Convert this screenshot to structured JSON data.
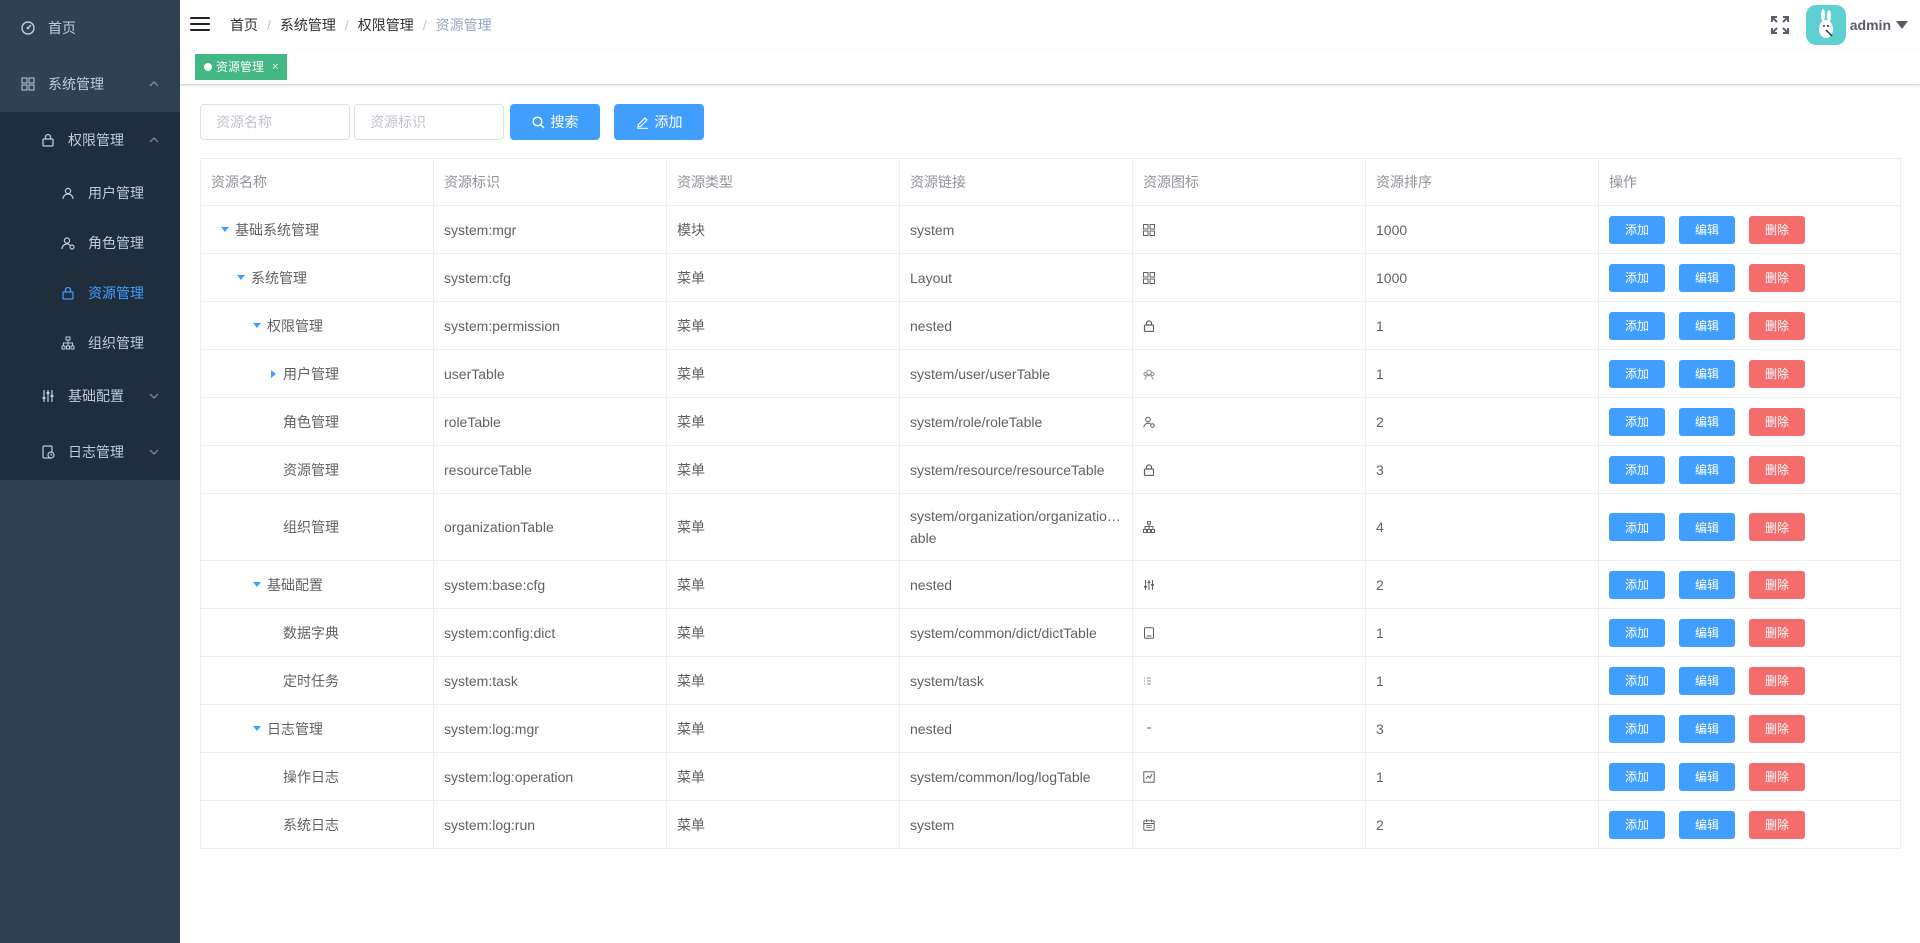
{
  "sidebar": {
    "items": [
      {
        "label": "首页",
        "icon": "dashboard-icon"
      },
      {
        "label": "系统管理",
        "icon": "grid-icon"
      },
      {
        "label": "权限管理",
        "icon": "lock-icon"
      },
      {
        "label": "用户管理",
        "icon": "peoples-icon"
      },
      {
        "label": "角色管理",
        "icon": "user-gear-icon"
      },
      {
        "label": "资源管理",
        "icon": "lock-icon",
        "active": true
      },
      {
        "label": "组织管理",
        "icon": "tree-icon"
      },
      {
        "label": "基础配置",
        "icon": "sliders-icon"
      },
      {
        "label": "日志管理",
        "icon": "log-icon"
      }
    ]
  },
  "header": {
    "breadcrumb": [
      "首页",
      "系统管理",
      "权限管理",
      "资源管理"
    ],
    "username": "admin"
  },
  "tags": {
    "active": "资源管理",
    "close": "×"
  },
  "toolbar": {
    "name_placeholder": "资源名称",
    "key_placeholder": "资源标识",
    "search_label": "搜索",
    "add_label": "添加"
  },
  "table": {
    "columns": [
      "资源名称",
      "资源标识",
      "资源类型",
      "资源链接",
      "资源图标",
      "资源排序",
      "操作"
    ],
    "ops": {
      "add": "添加",
      "edit": "编辑",
      "delete": "删除"
    },
    "rows": [
      {
        "name": "基础系统管理",
        "key": "system:mgr",
        "type": "模块",
        "link": "system",
        "icon": "grid-icon",
        "sort": "1000"
      },
      {
        "name": "系统管理",
        "key": "system:cfg",
        "type": "菜单",
        "link": "Layout",
        "icon": "grid-icon",
        "sort": "1000"
      },
      {
        "name": "权限管理",
        "key": "system:permission",
        "type": "菜单",
        "link": "nested",
        "icon": "lock-icon",
        "sort": "1"
      },
      {
        "name": "用户管理",
        "key": "userTable",
        "type": "菜单",
        "link": "system/user/userTable",
        "icon": "peoples-icon",
        "sort": "1"
      },
      {
        "name": "角色管理",
        "key": "roleTable",
        "type": "菜单",
        "link": "system/role/roleTable",
        "icon": "user-gear-icon",
        "sort": "2"
      },
      {
        "name": "资源管理",
        "key": "resourceTable",
        "type": "菜单",
        "link": "system/resource/resourceTable",
        "icon": "lock-icon",
        "sort": "3"
      },
      {
        "name": "组织管理",
        "key": "organizationTable",
        "type": "菜单",
        "link": "system/organization/organizatio…able",
        "icon": "tree-icon",
        "sort": "4"
      },
      {
        "name": "基础配置",
        "key": "system:base:cfg",
        "type": "菜单",
        "link": "nested",
        "icon": "sliders-icon",
        "sort": "2"
      },
      {
        "name": "数据字典",
        "key": "system:config:dict",
        "type": "菜单",
        "link": "system/common/dict/dictTable",
        "icon": "book-icon",
        "sort": "1"
      },
      {
        "name": "定时任务",
        "key": "system:task",
        "type": "菜单",
        "link": "system/task",
        "icon": "list-icon",
        "sort": "1"
      },
      {
        "name": "日志管理",
        "key": "system:log:mgr",
        "type": "菜单",
        "link": "nested",
        "icon": "dash-icon",
        "sort": "3"
      },
      {
        "name": "操作日志",
        "key": "system:log:operation",
        "type": "菜单",
        "link": "system/common/log/logTable",
        "icon": "chart-icon",
        "sort": "1"
      },
      {
        "name": "系统日志",
        "key": "system:log:run",
        "type": "菜单",
        "link": "system",
        "icon": "calendar-icon",
        "sort": "2"
      }
    ]
  }
}
